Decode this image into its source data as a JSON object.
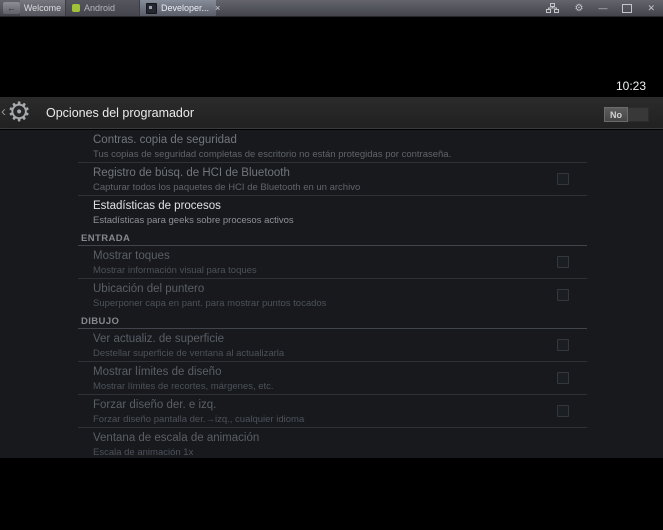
{
  "tab_bar": {
    "back_icon": "←",
    "tabs": [
      {
        "label": "Welcome"
      },
      {
        "label": "Android",
        "icon": "android-logo"
      },
      {
        "label": "Developer...",
        "icon": "developer-app",
        "close": "×"
      }
    ],
    "window_controls": {
      "minimize": "—",
      "maximize": "maximize-box",
      "close": "✕"
    }
  },
  "status": {
    "time": "10:23"
  },
  "action_bar": {
    "back_chevron": "‹",
    "gear_icon": "⚙",
    "title": "Opciones del programador",
    "master_switch": {
      "state_label": "No",
      "state": "off"
    }
  },
  "colors": {
    "android_green": "#a0c23a",
    "content_background": "#17191d",
    "action_bar_background": "#242424"
  },
  "settings_list": {
    "rows": [
      {
        "type": "item",
        "title": "Contras. copia de seguridad",
        "subtitle": "Tus copias de seguridad completas de escritorio no están protegidas por contraseña.",
        "emphasis": "normal",
        "checkbox": false
      },
      {
        "type": "item",
        "title": "Registro de búsq. de HCI de Bluetooth",
        "subtitle": "Capturar todos los paquetes de HCI de Bluetooth en un archivo",
        "emphasis": "normal",
        "checkbox": true,
        "checked": false
      },
      {
        "type": "item",
        "title": "Estadísticas de procesos",
        "subtitle": "Estadísticas para geeks sobre procesos activos",
        "emphasis": "bright",
        "checkbox": false
      },
      {
        "type": "header",
        "title": "ENTRADA"
      },
      {
        "type": "item",
        "title": "Mostrar toques",
        "subtitle": "Mostrar información visual para toques",
        "emphasis": "dim",
        "checkbox": true,
        "checked": false
      },
      {
        "type": "item",
        "title": "Ubicación del puntero",
        "subtitle": "Superponer capa en pant. para mostrar puntos tocados",
        "emphasis": "dim",
        "checkbox": true,
        "checked": false
      },
      {
        "type": "header",
        "title": "DIBUJO"
      },
      {
        "type": "item",
        "title": "Ver actualiz. de superficie",
        "subtitle": "Destellar superficie de ventana al actualizarla",
        "emphasis": "dim",
        "checkbox": true,
        "checked": false
      },
      {
        "type": "item",
        "title": "Mostrar límites de diseño",
        "subtitle": "Mostrar límites de recortes, márgenes, etc.",
        "emphasis": "dim",
        "checkbox": true,
        "checked": false
      },
      {
        "type": "item",
        "title": "Forzar diseño der. e izq.",
        "subtitle": "Forzar diseño pantalla der.→izq., cualquier idioma",
        "emphasis": "dim",
        "checkbox": true,
        "checked": false
      },
      {
        "type": "item",
        "title": "Ventana de escala de animación",
        "subtitle": "Escala de animación 1x",
        "emphasis": "dim",
        "checkbox": false
      }
    ]
  }
}
